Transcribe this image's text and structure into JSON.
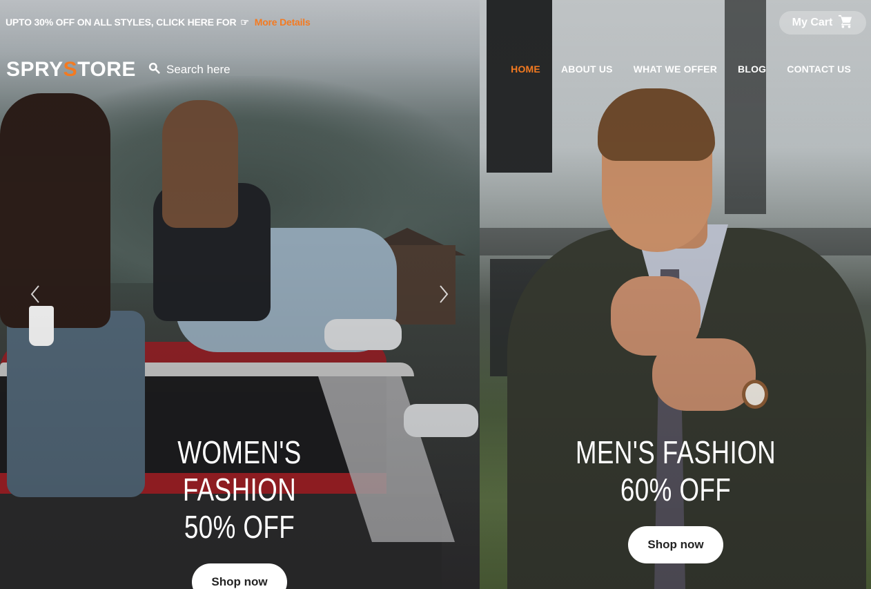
{
  "topbar": {
    "promo_text": "UPTO 30% OFF ON ALL STYLES, CLICK HERE FOR",
    "promo_icon": "pointing-hand-icon",
    "promo_link": "More Details",
    "cart_label": "My Cart",
    "cart_icon": "cart-icon"
  },
  "header": {
    "logo_part1": "SPRY",
    "logo_accent": "S",
    "logo_part2": "TORE",
    "search_placeholder": "Search here",
    "nav": [
      "HOME",
      "ABOUT US",
      "WHAT WE OFFER",
      "BLOG",
      "CONTACT US"
    ],
    "active_nav": "HOME"
  },
  "hero": {
    "left": {
      "line1": "WOMEN'S FASHION",
      "line2": "50% OFF",
      "button": "Shop now"
    },
    "right": {
      "line1": "MEN'S FASHION",
      "line2": "60% OFF",
      "button": "Shop now"
    }
  },
  "colors": {
    "accent": "#f47a20",
    "text": "#ffffff",
    "button_bg": "#ffffff",
    "button_text": "#222222"
  }
}
